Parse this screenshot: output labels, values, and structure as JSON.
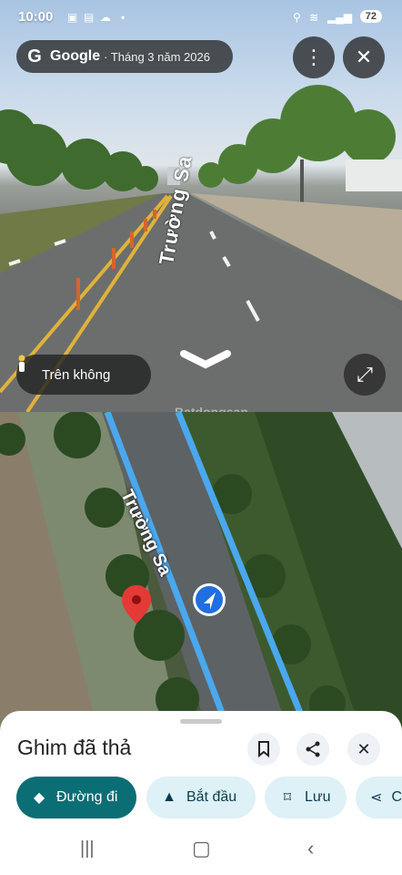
{
  "status_bar": {
    "time": "10:00",
    "battery": "72"
  },
  "header": {
    "brand": "Google",
    "date": "· Tháng 3 năm 2026"
  },
  "street": {
    "road_label": "Trường Sa",
    "mode_label": "Trên không",
    "watermark": "Batdongsan"
  },
  "map": {
    "road_label": "Trường Sa"
  },
  "sheet": {
    "title": "Ghim đã thả",
    "actions": [
      {
        "label": "Đường đi",
        "icon": "directions-icon"
      },
      {
        "label": "Bắt đầu",
        "icon": "navigation-arrow-icon"
      },
      {
        "label": "Lưu",
        "icon": "bookmark-icon"
      },
      {
        "label": "C",
        "icon": "share-icon"
      }
    ]
  },
  "colors": {
    "primary_chip": "#0b6e74",
    "secondary_chip": "#ddf1f7",
    "route": "#3a9be0",
    "pin": "#e53935"
  },
  "icons": [
    "google-g-icon",
    "more-vert-icon",
    "close-icon",
    "person-icon",
    "chevron-down-icon",
    "expand-icon",
    "map-pin-icon",
    "location-arrow-icon",
    "bookmark-icon",
    "share-icon",
    "close-icon",
    "recents-icon",
    "home-icon",
    "back-icon"
  ]
}
